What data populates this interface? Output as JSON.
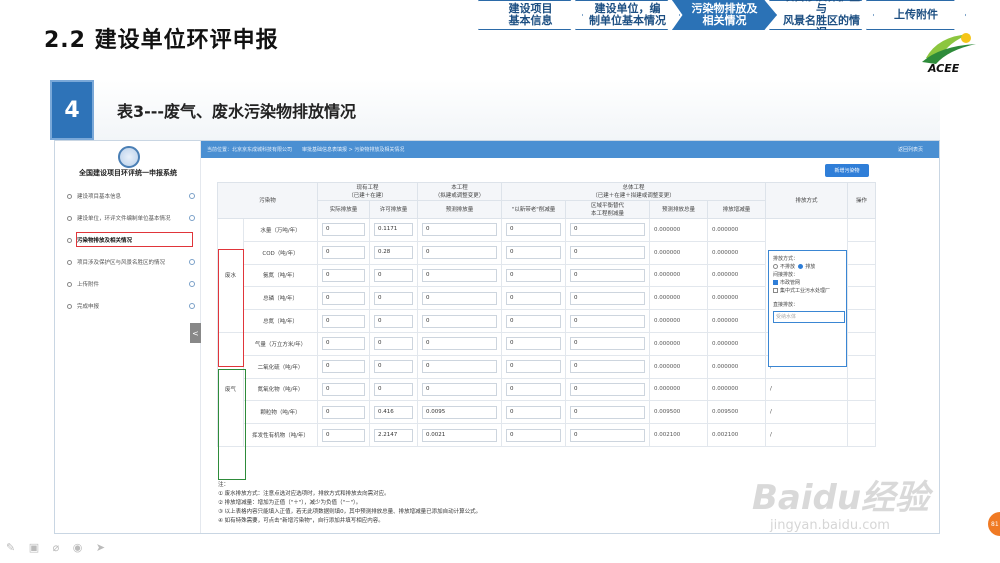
{
  "slide": {
    "title": "2.2  建设单位环评申报",
    "section_number": "4",
    "section_title": "表3---废气、废水污染物排放情况"
  },
  "steps": [
    {
      "label": "建设项目\n基本信息",
      "active": false
    },
    {
      "label": "建设单位，编\n制单位基本情况",
      "active": false
    },
    {
      "label": "污染物排放及\n相关情况",
      "active": true
    },
    {
      "label": "项目涉及保护区与\n风景名胜区的情况",
      "active": false
    },
    {
      "label": "上传附件",
      "active": false
    }
  ],
  "logo_text": "ACEE",
  "app": {
    "system_title": "全国建设项目环评统一申报系统",
    "nav": [
      {
        "label": "建设项目基本信息",
        "active": false
      },
      {
        "label": "建设单位，环评文件编制单位基本情况",
        "active": false
      },
      {
        "label": "污染物排放及相关情况",
        "active": true
      },
      {
        "label": "项目涉及保护区与风景名胜区的情况",
        "active": false
      },
      {
        "label": "上传附件",
        "active": false
      },
      {
        "label": "完成申报",
        "active": false
      }
    ],
    "collapse_icon": "<",
    "breadcrumb": "当前位置：北京京东成城科技有限公司　　审批基础信息表填报 > 污染物排放及相关情况",
    "back_link": "返回列表页",
    "add_button": "新增污染物"
  },
  "table": {
    "headers": {
      "pollutant": "污染物",
      "existing": "现有工程\n（已建＋在建）",
      "current": "本工程\n（拟建或调整变更）",
      "overall": "总体工程\n（已建＋在建＋拟建或调整变更）",
      "method": "排放方式",
      "action": "操作",
      "actual": "实际排放量",
      "permitted": "许可排放量",
      "predicted": "预测排放量",
      "reduction_old": "\"以新带老\"削减量",
      "regional": "区域平衡替代\n本工程削减量",
      "predicted_total": "预测排放总量",
      "change": "排放增减量"
    },
    "categories": [
      "废水",
      "废气"
    ],
    "rows": [
      {
        "item": "水量（万吨/年）",
        "actual": "0",
        "permitted": "0.1171",
        "predicted": "0",
        "old": "0",
        "regional": "0",
        "total": "0.000000",
        "change": "0.000000",
        "method": ""
      },
      {
        "item": "COD（吨/年）",
        "actual": "0",
        "permitted": "0.28",
        "predicted": "0",
        "old": "0",
        "regional": "0",
        "total": "0.000000",
        "change": "0.000000",
        "method": ""
      },
      {
        "item": "氨氮（吨/年）",
        "actual": "0",
        "permitted": "0",
        "predicted": "0",
        "old": "0",
        "regional": "0",
        "total": "0.000000",
        "change": "0.000000",
        "method": ""
      },
      {
        "item": "总磷（吨/年）",
        "actual": "0",
        "permitted": "0",
        "predicted": "0",
        "old": "0",
        "regional": "0",
        "total": "0.000000",
        "change": "0.000000",
        "method": ""
      },
      {
        "item": "总氮（吨/年）",
        "actual": "0",
        "permitted": "0",
        "predicted": "0",
        "old": "0",
        "regional": "0",
        "total": "0.000000",
        "change": "0.000000",
        "method": ""
      },
      {
        "item": "气量（万立方米/年）",
        "actual": "0",
        "permitted": "0",
        "predicted": "0",
        "old": "0",
        "regional": "0",
        "total": "0.000000",
        "change": "0.000000",
        "method": "/"
      },
      {
        "item": "二氧化硫（吨/年）",
        "actual": "0",
        "permitted": "0",
        "predicted": "0",
        "old": "0",
        "regional": "0",
        "total": "0.000000",
        "change": "0.000000",
        "method": "/"
      },
      {
        "item": "氮氧化物（吨/年）",
        "actual": "0",
        "permitted": "0",
        "predicted": "0",
        "old": "0",
        "regional": "0",
        "total": "0.000000",
        "change": "0.000000",
        "method": "/"
      },
      {
        "item": "颗粒物（吨/年）",
        "actual": "0",
        "permitted": "0.416",
        "predicted": "0.0095",
        "old": "0",
        "regional": "0",
        "total": "0.009500",
        "change": "0.009500",
        "method": "/"
      },
      {
        "item": "挥发性有机物（吨/年）",
        "actual": "0",
        "permitted": "2.2147",
        "predicted": "0.0021",
        "old": "0",
        "regional": "0",
        "total": "0.002100",
        "change": "0.002100",
        "method": "/"
      }
    ],
    "water_method": {
      "label": "排放方式：",
      "option_no": "不排放",
      "option_yes": "排放",
      "indirect_label": "间接排放：",
      "indirect_opt1": "市政管网",
      "indirect_opt2": "集中式工业污水处理厂",
      "direct_label": "直接排放：",
      "direct_placeholder": "受纳水体"
    }
  },
  "notes": [
    "注：",
    "① 废水排放方式：注意点选对应选项时，排放方式和排放去向需对应。",
    "② 排放增减量：增加为正值（\"＋\"），减少为负值（\"－\"）。",
    "③ 以上表格内容只能填入正值，若无此项数据则填0，其中预测排放总量、排放增减量已添加自动计算公式。",
    "④ 如有特殊需要，可点击\"新增污染物\"，自行添加并填写相应内容。"
  ],
  "watermark": "Baidu经验",
  "watermark_sub": "jingyan.baidu.com",
  "page_badge": "81",
  "colors": {
    "accent": "#2e73b8",
    "highlight_red": "#e0353a",
    "highlight_green": "#2e8b3a"
  }
}
